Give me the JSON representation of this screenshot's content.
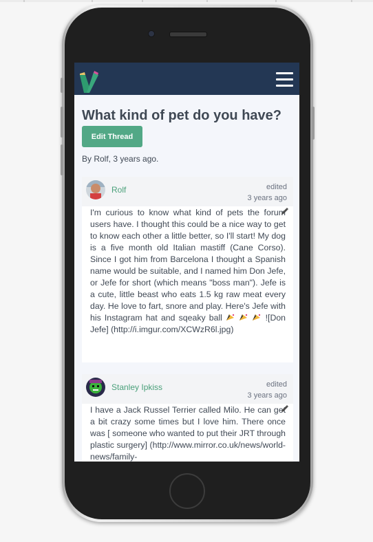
{
  "app": {
    "logo_icon": "vaporvue-logo-icon",
    "menu_icon": "hamburger-menu-icon"
  },
  "thread": {
    "title": "What kind of pet do you have?",
    "edit_label": "Edit Thread",
    "byline": "By Rolf, 3 years ago."
  },
  "posts": [
    {
      "author": "Rolf",
      "edited": "edited",
      "time": "3 years ago",
      "body": "I'm curious to know what kind of pets the forum users have. I thought this could be a nice way to get to know each other a little better, so I'll start! My dog is a five month old Italian mastiff (Cane Corso). Since I got him from Barcelona I thought a Spanish name would be suitable, and I named him Don Jefe, or Jefe for short (which means \"boss man\"). Jefe is a cute, little beast who eats 1.5 kg raw meat every day. He love to fart, snore and play. Here's Jefe with his Instagram hat and sqeaky ball",
      "body_tail": "![Don Jefe] (http://i.imgur.com/XCWzR6l.jpg)",
      "emoji_icons": [
        "party-horn-icon",
        "party-horn-icon",
        "party-horn-icon"
      ]
    },
    {
      "author": "Stanley Ipkiss",
      "edited": "edited",
      "time": "3 years ago",
      "body": "I have a Jack Russel Terrier called Milo. He can get a bit crazy some times but I love him. There once was [ someone who wanted to put their JRT through plastic surgery] (http://www.mirror.co.uk/news/world-news/family-"
    }
  ],
  "colors": {
    "navbar": "#233754",
    "accent": "#52a886",
    "author_link": "#4aa07a"
  }
}
